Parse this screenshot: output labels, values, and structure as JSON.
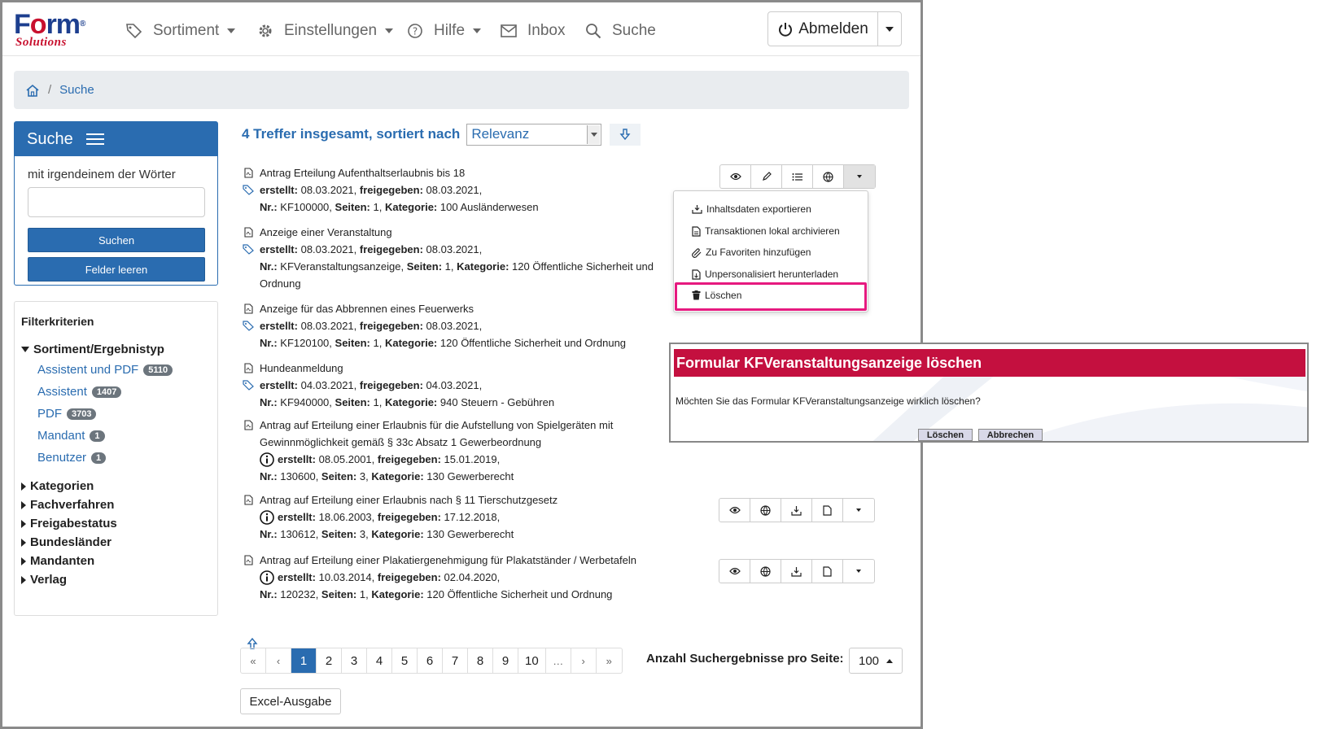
{
  "brand": {
    "name_part1": "F",
    "name_o": "o",
    "name_part2": "rm",
    "reg": "®",
    "tagline": "Solutions"
  },
  "nav": {
    "sortiment": "Sortiment",
    "einstellungen": "Einstellungen",
    "hilfe": "Hilfe",
    "inbox": "Inbox",
    "suche": "Suche",
    "logout": "Abmelden"
  },
  "breadcrumb": {
    "current": "Suche",
    "sep": "/"
  },
  "search_panel": {
    "title": "Suche",
    "label": "mit irgendeinem der Wörter",
    "input_value": "",
    "search_button": "Suchen",
    "clear_button": "Felder leeren"
  },
  "filters": {
    "title": "Filterkriterien",
    "expanded_group": "Sortiment/Ergebnistyp",
    "subitems": [
      {
        "label": "Assistent und PDF",
        "count": "5110"
      },
      {
        "label": "Assistent",
        "count": "1407"
      },
      {
        "label": "PDF",
        "count": "3703"
      },
      {
        "label": "Mandant",
        "count": "1"
      },
      {
        "label": "Benutzer",
        "count": "1"
      }
    ],
    "groups": [
      "Kategorien",
      "Fachverfahren",
      "Freigabestatus",
      "Bundesländer",
      "Mandanten",
      "Verlag"
    ]
  },
  "results_header": {
    "text": "4 Treffer insgesamt, sortiert nach",
    "sort_value": "Relevanz"
  },
  "labels": {
    "erstellt": "erstellt:",
    "freigegeben": "freigegeben:",
    "nr": "Nr.:",
    "seiten": "Seiten:",
    "kategorie": "Kategorie:"
  },
  "results": [
    {
      "title": "Antrag Erteilung Aufenthaltserlaubnis bis 18",
      "erstellt": "08.03.2021",
      "freigegeben": "08.03.2021",
      "nr": "KF100000",
      "seiten": "1",
      "kategorie": "100 Ausländerwesen"
    },
    {
      "title": "Anzeige einer Veranstaltung",
      "erstellt": "08.03.2021",
      "freigegeben": "08.03.2021",
      "nr": "KFVeranstaltungsanzeige",
      "seiten": "1",
      "kategorie": "120 Öffentliche Sicherheit und",
      "kategorie_cont": "Ordnung"
    },
    {
      "title": "Anzeige für das Abbrennen eines Feuerwerks",
      "erstellt": "08.03.2021",
      "freigegeben": "08.03.2021",
      "nr": "KF120100",
      "seiten": "1",
      "kategorie": "120 Öffentliche Sicherheit und Ordnung"
    },
    {
      "title": "Hundeanmeldung",
      "erstellt": "04.03.2021",
      "freigegeben": "04.03.2021",
      "nr": "KF940000",
      "seiten": "1",
      "kategorie": "940 Steuern - Gebühren"
    },
    {
      "title": "Antrag auf Erteilung einer Erlaubnis für die Aufstellung von Spielgeräten mit",
      "title2": "Gewinnmöglichkeit gemäß § 33c Absatz 1 Gewerbeordnung",
      "erstellt": "08.05.2001",
      "freigegeben": "15.01.2019",
      "nr": "130600",
      "seiten": "3",
      "kategorie": "130 Gewerberecht"
    },
    {
      "title": "Antrag auf Erteilung einer Erlaubnis nach § 11 Tierschutzgesetz",
      "erstellt": "18.06.2003",
      "freigegeben": "17.12.2018",
      "nr": "130612",
      "seiten": "3",
      "kategorie": "130 Gewerberecht"
    },
    {
      "title": "Antrag auf Erteilung einer Plakatiergenehmigung für Plakatständer / Werbetafeln",
      "erstellt": "10.03.2014",
      "freigegeben": "02.04.2020",
      "nr": "120232",
      "seiten": "1",
      "kategorie": "120 Öffentliche Sicherheit und Ordnung"
    }
  ],
  "dropdown_menu": {
    "items": [
      "Inhaltsdaten exportieren",
      "Transaktionen lokal archivieren",
      "Zu Favoriten hinzufügen",
      "Unpersonalisiert herunterladen",
      "Löschen"
    ]
  },
  "pagination": {
    "items": [
      "«",
      "‹",
      "1",
      "2",
      "3",
      "4",
      "5",
      "6",
      "7",
      "8",
      "9",
      "10",
      "…",
      "›",
      "»"
    ],
    "active": "1",
    "per_page_label": "Anzahl Suchergebnisse pro Seite:",
    "per_page_value": "100",
    "excel": "Excel-Ausgabe"
  },
  "dialog": {
    "title": "Formular KFVeranstaltungsanzeige löschen",
    "message": "Möchten Sie das Formular KFVeranstaltungsanzeige wirklich löschen?",
    "confirm": "Löschen",
    "cancel": "Abbrechen"
  },
  "colors": {
    "primary": "#2a6cb0",
    "dialog_title": "#c4103f",
    "highlight": "#e6197f"
  }
}
